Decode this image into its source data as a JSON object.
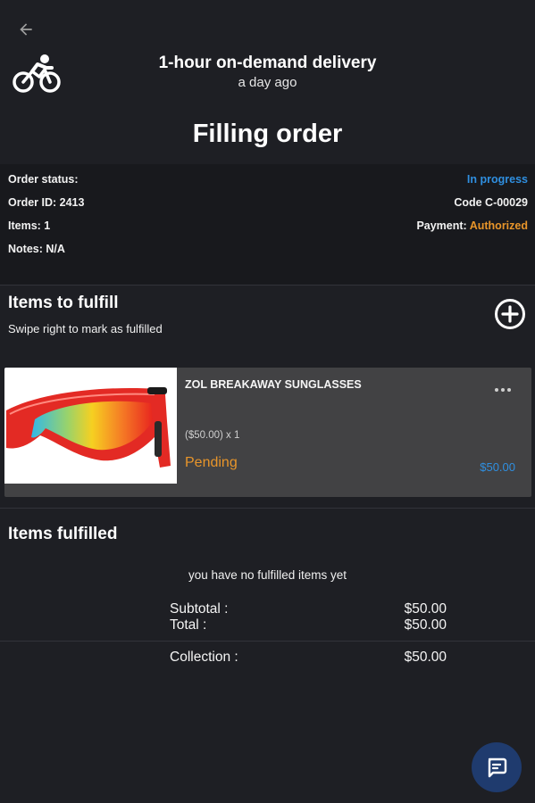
{
  "header": {
    "title": "1-hour on-demand delivery",
    "subtitle": "a day ago"
  },
  "page_title": "Filling order",
  "order": {
    "status_label": "Order status:",
    "status_value": "In progress",
    "id_label": "Order ID: 2413",
    "code": "Code C-00029",
    "items_label": "Items: 1",
    "payment_label": "Payment: ",
    "payment_value": "Authorized",
    "notes_label": "Notes: N/A"
  },
  "to_fulfill": {
    "title": "Items to fulfill",
    "hint": "Swipe right to mark as fulfilled"
  },
  "item": {
    "name": "ZOL BREAKAWAY SUNGLASSES",
    "qty": "($50.00) x 1",
    "status": "Pending",
    "price": "$50.00"
  },
  "fulfilled": {
    "title": "Items fulfilled",
    "empty": "you have no fulfilled items yet"
  },
  "totals": {
    "subtotal_label": "Subtotal :",
    "subtotal_value": "$50.00",
    "total_label": "Total :",
    "total_value": "$50.00",
    "collection_label": "Collection :",
    "collection_value": "$50.00"
  },
  "colors": {
    "background": "#1e1f24",
    "accent_blue": "#2f8fe0",
    "accent_orange": "#e8952a",
    "card": "#424244",
    "fab": "#1f3b6e"
  },
  "icons": {
    "back": "arrow-left-icon",
    "delivery": "bicycle-rider-icon",
    "add": "plus-circle-icon",
    "more": "more-horizontal-icon",
    "chat": "chat-bubble-icon"
  }
}
